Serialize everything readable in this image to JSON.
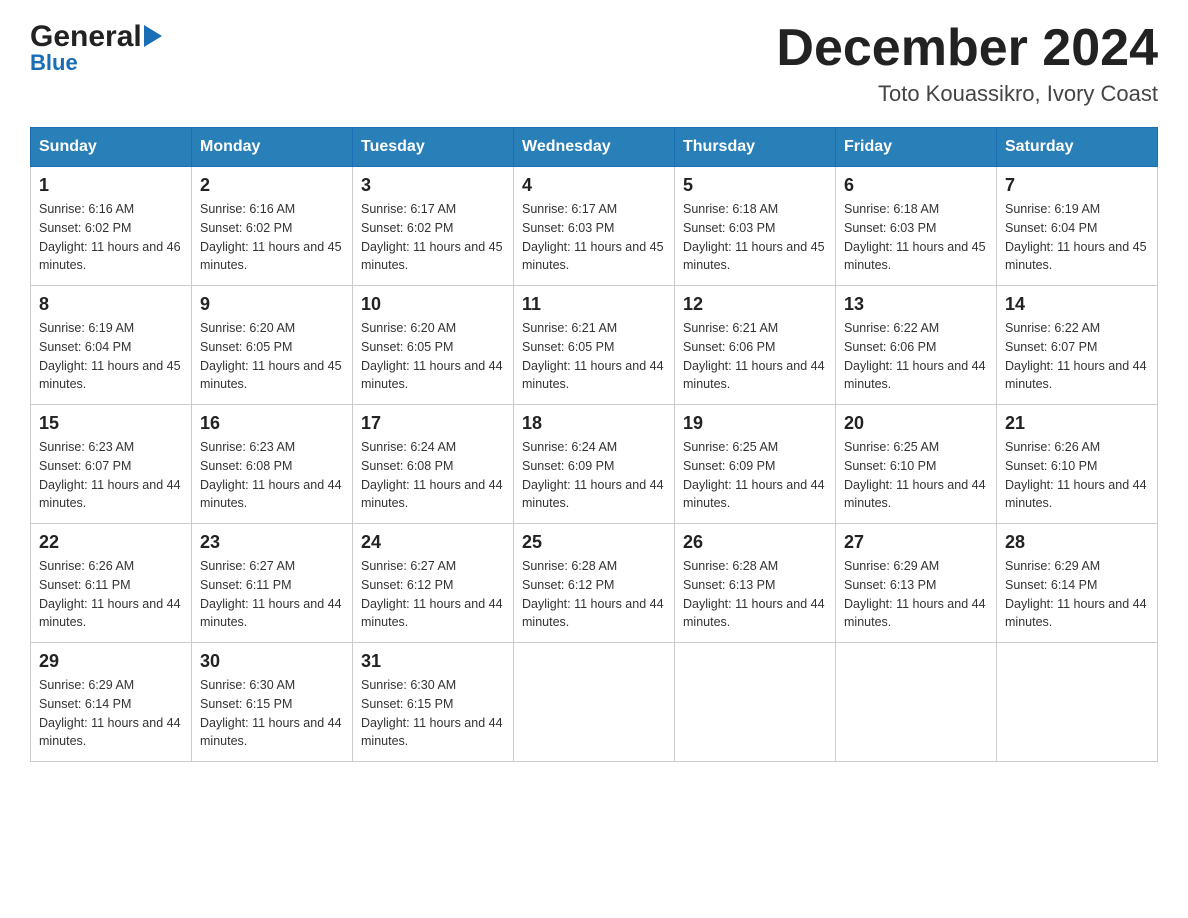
{
  "header": {
    "logo_line1": "General",
    "logo_line2": "Blue",
    "month_title": "December 2024",
    "location": "Toto Kouassikro, Ivory Coast"
  },
  "calendar": {
    "days_of_week": [
      "Sunday",
      "Monday",
      "Tuesday",
      "Wednesday",
      "Thursday",
      "Friday",
      "Saturday"
    ],
    "weeks": [
      [
        {
          "day": "1",
          "sunrise": "Sunrise: 6:16 AM",
          "sunset": "Sunset: 6:02 PM",
          "daylight": "Daylight: 11 hours and 46 minutes."
        },
        {
          "day": "2",
          "sunrise": "Sunrise: 6:16 AM",
          "sunset": "Sunset: 6:02 PM",
          "daylight": "Daylight: 11 hours and 45 minutes."
        },
        {
          "day": "3",
          "sunrise": "Sunrise: 6:17 AM",
          "sunset": "Sunset: 6:02 PM",
          "daylight": "Daylight: 11 hours and 45 minutes."
        },
        {
          "day": "4",
          "sunrise": "Sunrise: 6:17 AM",
          "sunset": "Sunset: 6:03 PM",
          "daylight": "Daylight: 11 hours and 45 minutes."
        },
        {
          "day": "5",
          "sunrise": "Sunrise: 6:18 AM",
          "sunset": "Sunset: 6:03 PM",
          "daylight": "Daylight: 11 hours and 45 minutes."
        },
        {
          "day": "6",
          "sunrise": "Sunrise: 6:18 AM",
          "sunset": "Sunset: 6:03 PM",
          "daylight": "Daylight: 11 hours and 45 minutes."
        },
        {
          "day": "7",
          "sunrise": "Sunrise: 6:19 AM",
          "sunset": "Sunset: 6:04 PM",
          "daylight": "Daylight: 11 hours and 45 minutes."
        }
      ],
      [
        {
          "day": "8",
          "sunrise": "Sunrise: 6:19 AM",
          "sunset": "Sunset: 6:04 PM",
          "daylight": "Daylight: 11 hours and 45 minutes."
        },
        {
          "day": "9",
          "sunrise": "Sunrise: 6:20 AM",
          "sunset": "Sunset: 6:05 PM",
          "daylight": "Daylight: 11 hours and 45 minutes."
        },
        {
          "day": "10",
          "sunrise": "Sunrise: 6:20 AM",
          "sunset": "Sunset: 6:05 PM",
          "daylight": "Daylight: 11 hours and 44 minutes."
        },
        {
          "day": "11",
          "sunrise": "Sunrise: 6:21 AM",
          "sunset": "Sunset: 6:05 PM",
          "daylight": "Daylight: 11 hours and 44 minutes."
        },
        {
          "day": "12",
          "sunrise": "Sunrise: 6:21 AM",
          "sunset": "Sunset: 6:06 PM",
          "daylight": "Daylight: 11 hours and 44 minutes."
        },
        {
          "day": "13",
          "sunrise": "Sunrise: 6:22 AM",
          "sunset": "Sunset: 6:06 PM",
          "daylight": "Daylight: 11 hours and 44 minutes."
        },
        {
          "day": "14",
          "sunrise": "Sunrise: 6:22 AM",
          "sunset": "Sunset: 6:07 PM",
          "daylight": "Daylight: 11 hours and 44 minutes."
        }
      ],
      [
        {
          "day": "15",
          "sunrise": "Sunrise: 6:23 AM",
          "sunset": "Sunset: 6:07 PM",
          "daylight": "Daylight: 11 hours and 44 minutes."
        },
        {
          "day": "16",
          "sunrise": "Sunrise: 6:23 AM",
          "sunset": "Sunset: 6:08 PM",
          "daylight": "Daylight: 11 hours and 44 minutes."
        },
        {
          "day": "17",
          "sunrise": "Sunrise: 6:24 AM",
          "sunset": "Sunset: 6:08 PM",
          "daylight": "Daylight: 11 hours and 44 minutes."
        },
        {
          "day": "18",
          "sunrise": "Sunrise: 6:24 AM",
          "sunset": "Sunset: 6:09 PM",
          "daylight": "Daylight: 11 hours and 44 minutes."
        },
        {
          "day": "19",
          "sunrise": "Sunrise: 6:25 AM",
          "sunset": "Sunset: 6:09 PM",
          "daylight": "Daylight: 11 hours and 44 minutes."
        },
        {
          "day": "20",
          "sunrise": "Sunrise: 6:25 AM",
          "sunset": "Sunset: 6:10 PM",
          "daylight": "Daylight: 11 hours and 44 minutes."
        },
        {
          "day": "21",
          "sunrise": "Sunrise: 6:26 AM",
          "sunset": "Sunset: 6:10 PM",
          "daylight": "Daylight: 11 hours and 44 minutes."
        }
      ],
      [
        {
          "day": "22",
          "sunrise": "Sunrise: 6:26 AM",
          "sunset": "Sunset: 6:11 PM",
          "daylight": "Daylight: 11 hours and 44 minutes."
        },
        {
          "day": "23",
          "sunrise": "Sunrise: 6:27 AM",
          "sunset": "Sunset: 6:11 PM",
          "daylight": "Daylight: 11 hours and 44 minutes."
        },
        {
          "day": "24",
          "sunrise": "Sunrise: 6:27 AM",
          "sunset": "Sunset: 6:12 PM",
          "daylight": "Daylight: 11 hours and 44 minutes."
        },
        {
          "day": "25",
          "sunrise": "Sunrise: 6:28 AM",
          "sunset": "Sunset: 6:12 PM",
          "daylight": "Daylight: 11 hours and 44 minutes."
        },
        {
          "day": "26",
          "sunrise": "Sunrise: 6:28 AM",
          "sunset": "Sunset: 6:13 PM",
          "daylight": "Daylight: 11 hours and 44 minutes."
        },
        {
          "day": "27",
          "sunrise": "Sunrise: 6:29 AM",
          "sunset": "Sunset: 6:13 PM",
          "daylight": "Daylight: 11 hours and 44 minutes."
        },
        {
          "day": "28",
          "sunrise": "Sunrise: 6:29 AM",
          "sunset": "Sunset: 6:14 PM",
          "daylight": "Daylight: 11 hours and 44 minutes."
        }
      ],
      [
        {
          "day": "29",
          "sunrise": "Sunrise: 6:29 AM",
          "sunset": "Sunset: 6:14 PM",
          "daylight": "Daylight: 11 hours and 44 minutes."
        },
        {
          "day": "30",
          "sunrise": "Sunrise: 6:30 AM",
          "sunset": "Sunset: 6:15 PM",
          "daylight": "Daylight: 11 hours and 44 minutes."
        },
        {
          "day": "31",
          "sunrise": "Sunrise: 6:30 AM",
          "sunset": "Sunset: 6:15 PM",
          "daylight": "Daylight: 11 hours and 44 minutes."
        },
        null,
        null,
        null,
        null
      ]
    ]
  }
}
